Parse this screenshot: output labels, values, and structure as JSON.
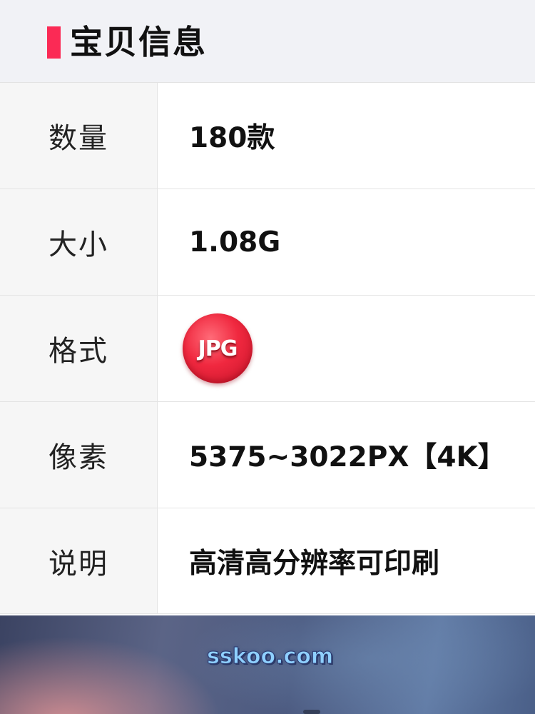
{
  "header": {
    "title": "宝贝信息",
    "accent_color": "#fb2a55"
  },
  "rows": [
    {
      "label": "数量",
      "value": "180款"
    },
    {
      "label": "大小",
      "value": "1.08G"
    },
    {
      "label": "格式",
      "value": "JPG",
      "badge_color": "#f0283f"
    },
    {
      "label": "像素",
      "value": "5375~3022PX【4K】"
    },
    {
      "label": "说明",
      "value": "高清高分辨率可印刷"
    }
  ],
  "banner": {
    "watermark": "sskoo.com"
  }
}
